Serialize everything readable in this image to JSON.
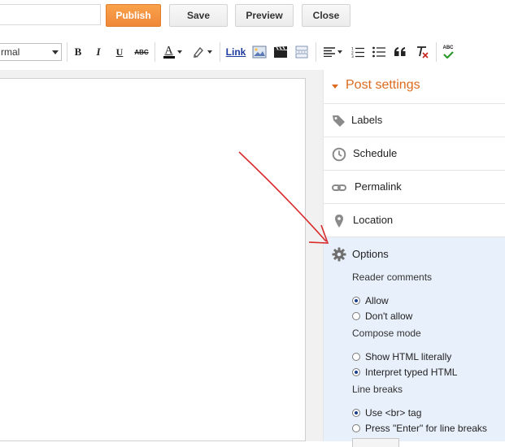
{
  "actions": {
    "publish_label": "Publish",
    "save_label": "Save",
    "preview_label": "Preview",
    "close_label": "Close"
  },
  "toolbar": {
    "font_value": "rmal",
    "bold": "B",
    "italic": "I",
    "underline": "U",
    "strikethrough": "ABC",
    "text_color": "A",
    "link_label": "Link",
    "spellcheck": "ABC"
  },
  "sidebar": {
    "header": "Post settings",
    "items": [
      {
        "label": "Labels",
        "icon": "tag-icon"
      },
      {
        "label": "Schedule",
        "icon": "clock-icon"
      },
      {
        "label": "Permalink",
        "icon": "link-icon"
      },
      {
        "label": "Location",
        "icon": "map-pin-icon"
      }
    ],
    "options": {
      "title": "Options",
      "icon": "gear-icon",
      "reader_comments": {
        "label": "Reader comments",
        "choices": [
          {
            "label": "Allow",
            "selected": true
          },
          {
            "label": "Don't allow",
            "selected": false
          }
        ]
      },
      "compose_mode": {
        "label": "Compose mode",
        "choices": [
          {
            "label": "Show HTML literally",
            "selected": false
          },
          {
            "label": "Interpret typed HTML",
            "selected": true
          }
        ]
      },
      "line_breaks": {
        "label": "Line breaks",
        "choices": [
          {
            "label": "Use <br> tag",
            "selected": true
          },
          {
            "label": "Press \"Enter\" for line breaks",
            "selected": false
          }
        ]
      }
    }
  },
  "colors": {
    "publish_bg": "#f0883a",
    "accent_orange": "#dd6b1f",
    "options_bg": "#e8f0fb",
    "arrow": "#d92b2b"
  }
}
